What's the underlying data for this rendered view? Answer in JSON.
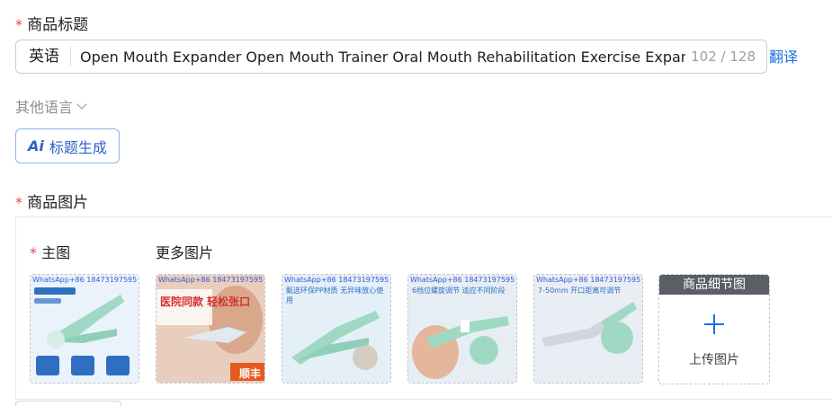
{
  "title_section": {
    "required_mark": "*",
    "label": "商品标题",
    "language_prefix": "英语",
    "title_value": "Open Mouth Expander Open Mouth Trainer Oral Mouth Rehabilitation Exercise Expansi",
    "counter": "102 / 128",
    "translate_label": "翻译"
  },
  "other_languages": {
    "label": "其他语言",
    "icon": "chevron-down-icon"
  },
  "ai_button": {
    "icon_text": "Ai",
    "label": "标题生成"
  },
  "images_section": {
    "required_mark": "*",
    "label": "商品图片",
    "main_image": {
      "required_mark": "*",
      "label": "主图"
    },
    "more_images": {
      "label": "更多图片"
    },
    "thumbnails": [
      {
        "watermark": "WhatsApp+86 18473197595",
        "text": ""
      },
      {
        "watermark": "WhatsApp+86 18473197595",
        "text": "医院同款 轻松张口",
        "badge": "顺丰"
      },
      {
        "watermark": "WhatsApp+86 18473197595",
        "text": "甄选环保PP材质 无异味放心使用"
      },
      {
        "watermark": "WhatsApp+86 18473197595",
        "text": "6档位螺旋调节 适应不同阶段"
      },
      {
        "watermark": "WhatsApp+86 18473197595",
        "text": "7-50mm 开口距离可调节"
      }
    ],
    "upload_tile": {
      "header": "商品细节图",
      "label": "上传图片"
    }
  },
  "colors": {
    "required": "#e5484d",
    "link": "#1d6fe0",
    "ai_accent": "#2c5fc8",
    "product_mint": "#9fd9c4"
  }
}
